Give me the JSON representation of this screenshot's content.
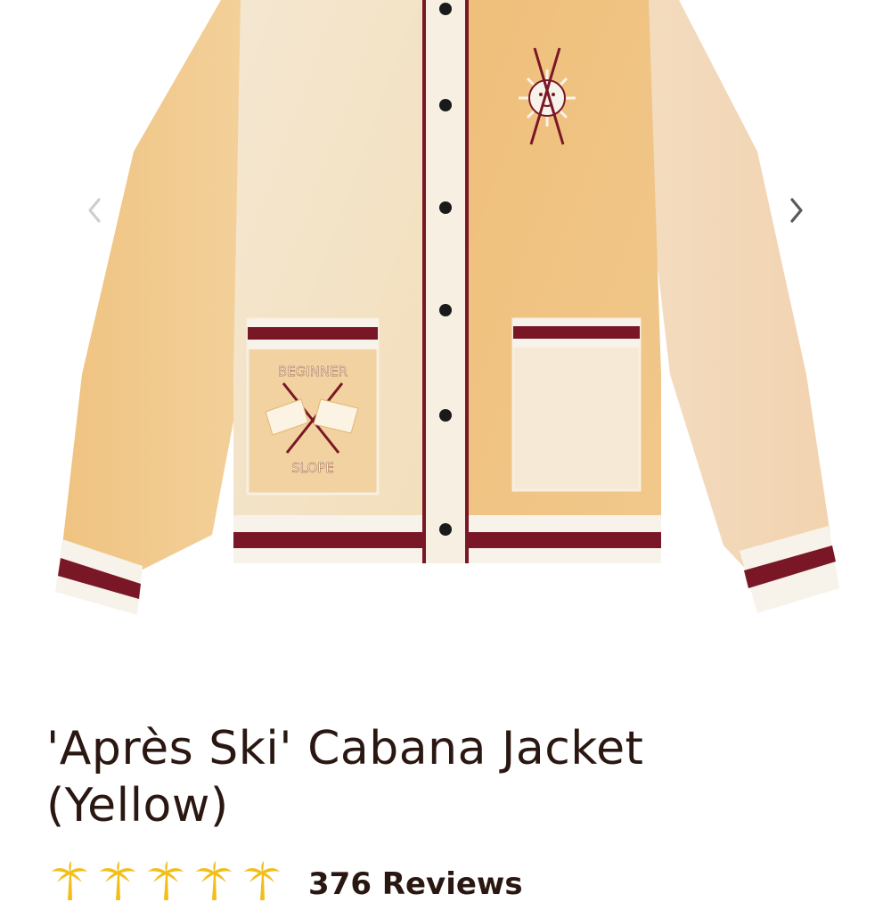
{
  "gallery": {
    "prev_icon": "chevron-left-icon",
    "next_icon": "chevron-right-icon",
    "jacket": {
      "pocket_text_top": "BEGINNER",
      "pocket_text_bottom": "SLOPE"
    }
  },
  "product": {
    "title_line1": "'Après Ski' Cabana Jacket",
    "title_line2": "(Yellow)"
  },
  "rating": {
    "icon": "palm-tree-icon",
    "stars": 5,
    "reviews_label": "376 Reviews"
  },
  "colors": {
    "body_yellow": "#f0c98f",
    "cream": "#f5e4c9",
    "burgundy": "#7a1726",
    "text": "#2a1712",
    "palm": "#f2be1a"
  }
}
